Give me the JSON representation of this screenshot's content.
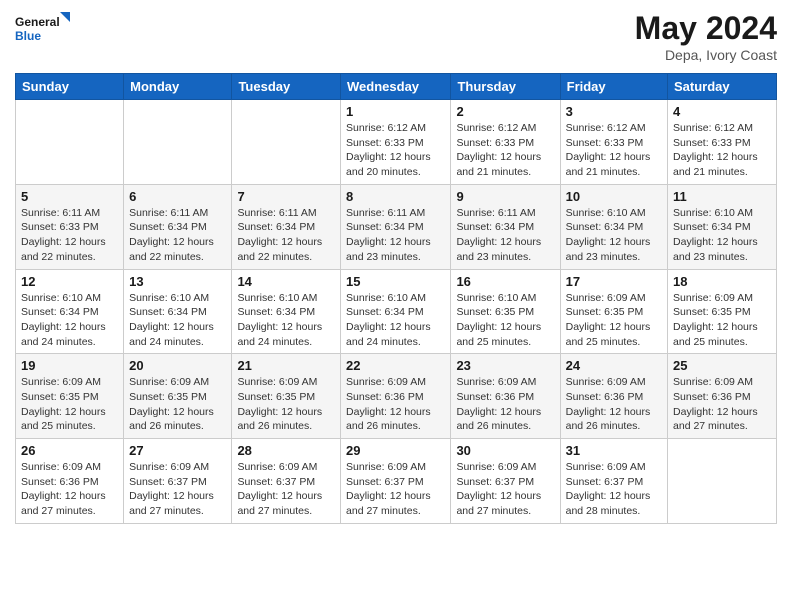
{
  "header": {
    "logo_line1": "General",
    "logo_line2": "Blue",
    "title": "May 2024",
    "location": "Depa, Ivory Coast"
  },
  "weekdays": [
    "Sunday",
    "Monday",
    "Tuesday",
    "Wednesday",
    "Thursday",
    "Friday",
    "Saturday"
  ],
  "weeks": [
    [
      {
        "day": "",
        "info": ""
      },
      {
        "day": "",
        "info": ""
      },
      {
        "day": "",
        "info": ""
      },
      {
        "day": "1",
        "info": "Sunrise: 6:12 AM\nSunset: 6:33 PM\nDaylight: 12 hours\nand 20 minutes."
      },
      {
        "day": "2",
        "info": "Sunrise: 6:12 AM\nSunset: 6:33 PM\nDaylight: 12 hours\nand 21 minutes."
      },
      {
        "day": "3",
        "info": "Sunrise: 6:12 AM\nSunset: 6:33 PM\nDaylight: 12 hours\nand 21 minutes."
      },
      {
        "day": "4",
        "info": "Sunrise: 6:12 AM\nSunset: 6:33 PM\nDaylight: 12 hours\nand 21 minutes."
      }
    ],
    [
      {
        "day": "5",
        "info": "Sunrise: 6:11 AM\nSunset: 6:33 PM\nDaylight: 12 hours\nand 22 minutes."
      },
      {
        "day": "6",
        "info": "Sunrise: 6:11 AM\nSunset: 6:34 PM\nDaylight: 12 hours\nand 22 minutes."
      },
      {
        "day": "7",
        "info": "Sunrise: 6:11 AM\nSunset: 6:34 PM\nDaylight: 12 hours\nand 22 minutes."
      },
      {
        "day": "8",
        "info": "Sunrise: 6:11 AM\nSunset: 6:34 PM\nDaylight: 12 hours\nand 23 minutes."
      },
      {
        "day": "9",
        "info": "Sunrise: 6:11 AM\nSunset: 6:34 PM\nDaylight: 12 hours\nand 23 minutes."
      },
      {
        "day": "10",
        "info": "Sunrise: 6:10 AM\nSunset: 6:34 PM\nDaylight: 12 hours\nand 23 minutes."
      },
      {
        "day": "11",
        "info": "Sunrise: 6:10 AM\nSunset: 6:34 PM\nDaylight: 12 hours\nand 23 minutes."
      }
    ],
    [
      {
        "day": "12",
        "info": "Sunrise: 6:10 AM\nSunset: 6:34 PM\nDaylight: 12 hours\nand 24 minutes."
      },
      {
        "day": "13",
        "info": "Sunrise: 6:10 AM\nSunset: 6:34 PM\nDaylight: 12 hours\nand 24 minutes."
      },
      {
        "day": "14",
        "info": "Sunrise: 6:10 AM\nSunset: 6:34 PM\nDaylight: 12 hours\nand 24 minutes."
      },
      {
        "day": "15",
        "info": "Sunrise: 6:10 AM\nSunset: 6:34 PM\nDaylight: 12 hours\nand 24 minutes."
      },
      {
        "day": "16",
        "info": "Sunrise: 6:10 AM\nSunset: 6:35 PM\nDaylight: 12 hours\nand 25 minutes."
      },
      {
        "day": "17",
        "info": "Sunrise: 6:09 AM\nSunset: 6:35 PM\nDaylight: 12 hours\nand 25 minutes."
      },
      {
        "day": "18",
        "info": "Sunrise: 6:09 AM\nSunset: 6:35 PM\nDaylight: 12 hours\nand 25 minutes."
      }
    ],
    [
      {
        "day": "19",
        "info": "Sunrise: 6:09 AM\nSunset: 6:35 PM\nDaylight: 12 hours\nand 25 minutes."
      },
      {
        "day": "20",
        "info": "Sunrise: 6:09 AM\nSunset: 6:35 PM\nDaylight: 12 hours\nand 26 minutes."
      },
      {
        "day": "21",
        "info": "Sunrise: 6:09 AM\nSunset: 6:35 PM\nDaylight: 12 hours\nand 26 minutes."
      },
      {
        "day": "22",
        "info": "Sunrise: 6:09 AM\nSunset: 6:36 PM\nDaylight: 12 hours\nand 26 minutes."
      },
      {
        "day": "23",
        "info": "Sunrise: 6:09 AM\nSunset: 6:36 PM\nDaylight: 12 hours\nand 26 minutes."
      },
      {
        "day": "24",
        "info": "Sunrise: 6:09 AM\nSunset: 6:36 PM\nDaylight: 12 hours\nand 26 minutes."
      },
      {
        "day": "25",
        "info": "Sunrise: 6:09 AM\nSunset: 6:36 PM\nDaylight: 12 hours\nand 27 minutes."
      }
    ],
    [
      {
        "day": "26",
        "info": "Sunrise: 6:09 AM\nSunset: 6:36 PM\nDaylight: 12 hours\nand 27 minutes."
      },
      {
        "day": "27",
        "info": "Sunrise: 6:09 AM\nSunset: 6:37 PM\nDaylight: 12 hours\nand 27 minutes."
      },
      {
        "day": "28",
        "info": "Sunrise: 6:09 AM\nSunset: 6:37 PM\nDaylight: 12 hours\nand 27 minutes."
      },
      {
        "day": "29",
        "info": "Sunrise: 6:09 AM\nSunset: 6:37 PM\nDaylight: 12 hours\nand 27 minutes."
      },
      {
        "day": "30",
        "info": "Sunrise: 6:09 AM\nSunset: 6:37 PM\nDaylight: 12 hours\nand 27 minutes."
      },
      {
        "day": "31",
        "info": "Sunrise: 6:09 AM\nSunset: 6:37 PM\nDaylight: 12 hours\nand 28 minutes."
      },
      {
        "day": "",
        "info": ""
      }
    ]
  ]
}
